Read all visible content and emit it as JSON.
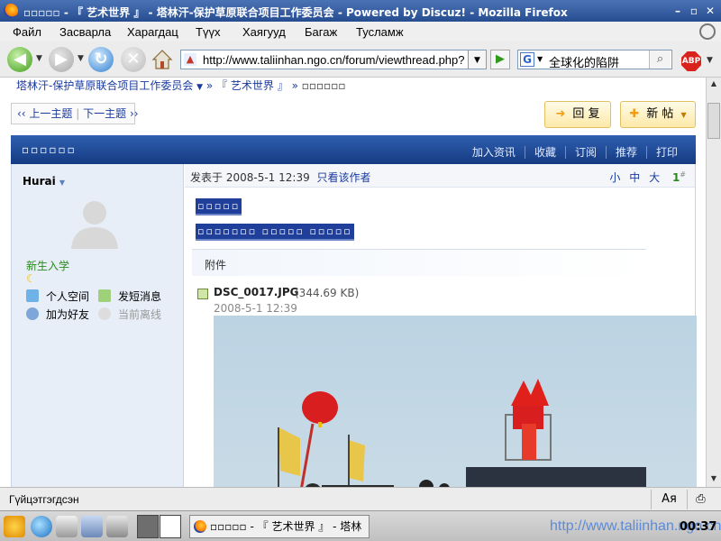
{
  "window": {
    "title": "▫▫▫▫▫ - 『 艺术世界 』 - 塔林汗-保护草原联合项目工作委员会 - Powered by Discuz! - Mozilla Firefox"
  },
  "menu": {
    "file": "Файл",
    "edit": "Засварла",
    "view": "Харагдац",
    "history": "Түүх",
    "bookmarks": "Хаягууд",
    "tools": "Багаж",
    "help": "Тусламж"
  },
  "toolbar": {
    "url": "http://www.taliinhan.ngo.cn/forum/viewthread.php?",
    "search_value": "全球化的陷阱",
    "abp_label": "ABP"
  },
  "page": {
    "breadcrumb_forum": "塔林汗-保护草原联合项目工作委员会",
    "breadcrumb_sep1": "»",
    "breadcrumb_board": "『 艺术世界 』",
    "breadcrumb_sep2": "»",
    "breadcrumb_thread": "▫▫▫▫▫▫",
    "prev_topic": "‹‹ 上一主题",
    "next_topic": "下一主题 ››",
    "reply_label": "回 复",
    "newpost_label": "新 帖",
    "thread_title": "▫▫▫▫▫▫",
    "thread_tools": [
      "加入资讯",
      "收藏",
      "订阅",
      "推荐",
      "打印"
    ],
    "user": {
      "name": "Hurai",
      "group": "新生入学",
      "actions": [
        "个人空间",
        "发短消息",
        "加为好友",
        "当前离线"
      ]
    },
    "post": {
      "posted_prefix": "发表于",
      "posted_time": "2008-5-1 12:39",
      "only_author": "只看该作者",
      "font_sizes": [
        "小",
        "中",
        "大"
      ],
      "floor": "1",
      "floor_mark": "#",
      "title_text": "▫▫▫▫▫",
      "subtitle_text": "▫▫▫▫▫▫▫ ▫▫▫▫▫ ▫▫▫▫▫",
      "attachment_label": "附件",
      "file_name": "DSC_0017.JPG",
      "file_size": "(344.69 KB)",
      "file_date": "2008-5-1 12:39"
    }
  },
  "statusbar": {
    "status": "Гүйцэтгэгдсэн",
    "keyboard": "Aя"
  },
  "taskbar": {
    "window_label": "▫▫▫▫▫ - 『 艺术世界 』 - 塔林",
    "watermark": "http://www.taliinhan.ngo.cn",
    "clock": "00:37"
  },
  "colors": {
    "title_bar": "#3a62a6",
    "thread_header": "#1f4a96",
    "link": "#1a3a9f",
    "user_group": "#2a8a1f"
  }
}
